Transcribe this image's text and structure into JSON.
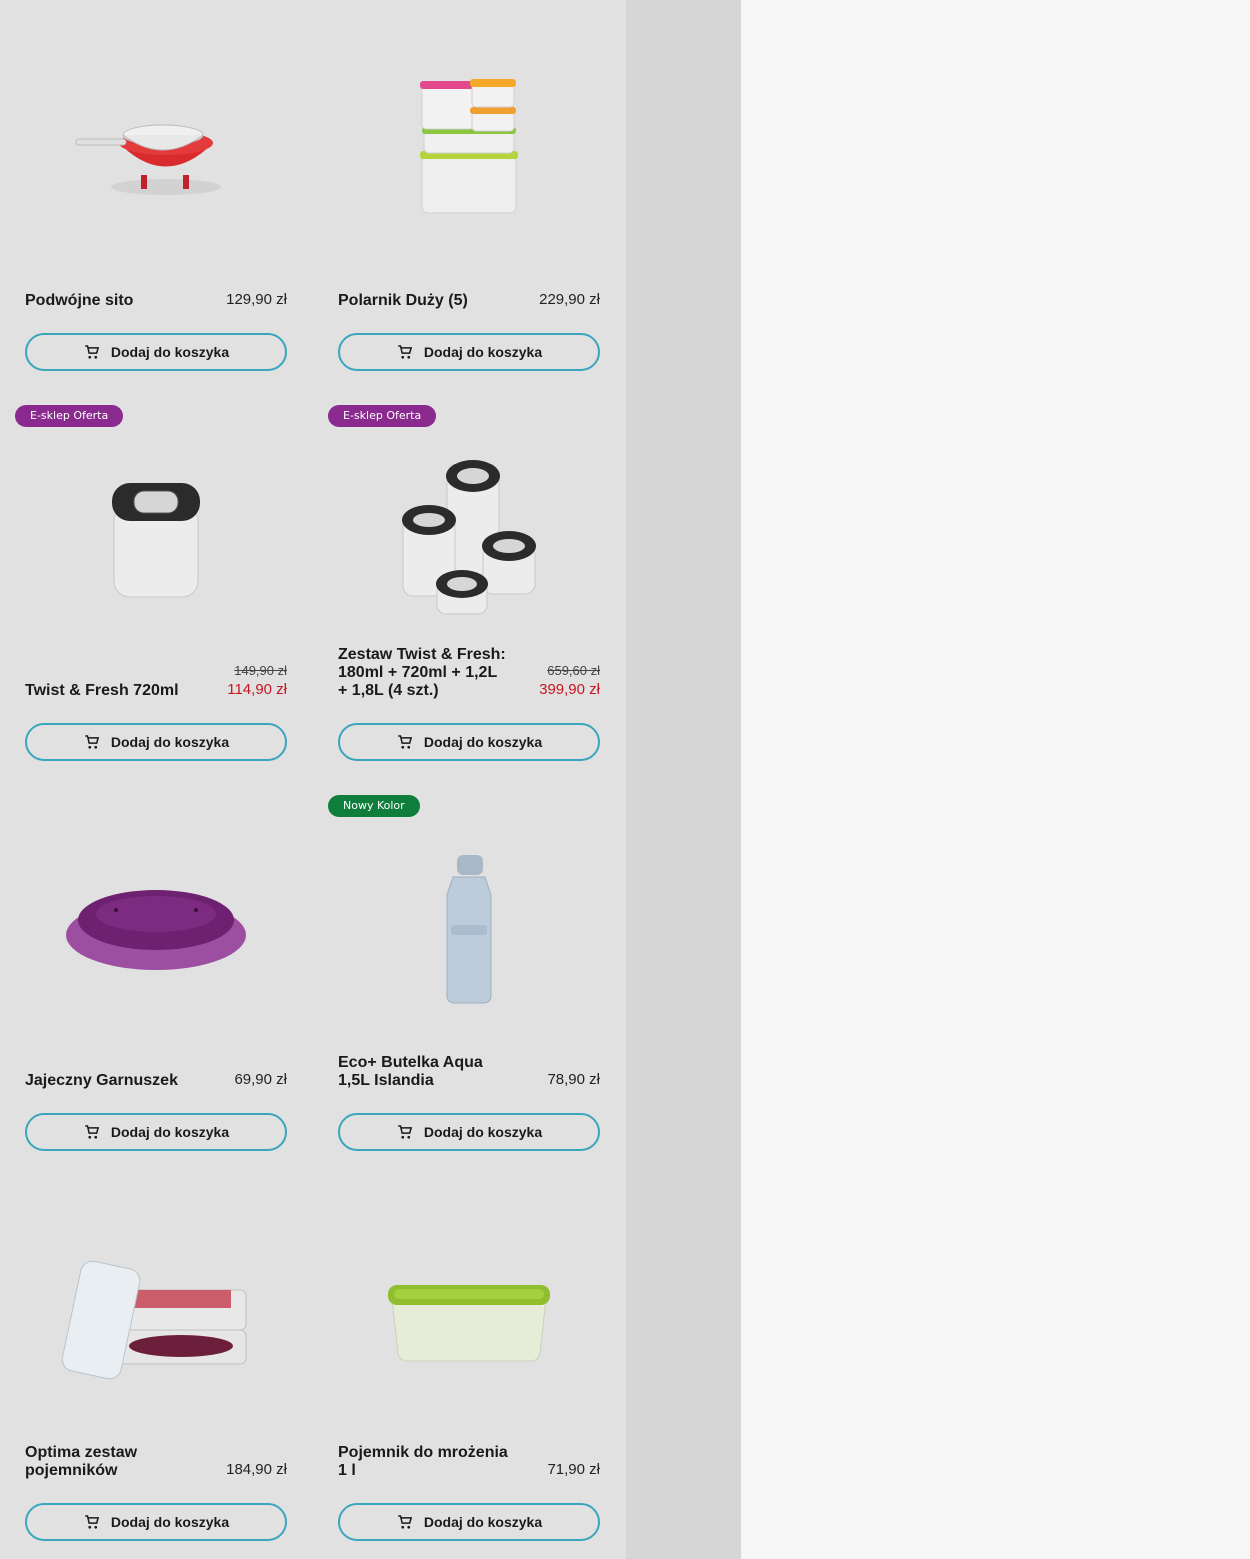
{
  "products": [
    {
      "name": "Podwójne sito",
      "price": "129,90 zł",
      "button": "Dodaj do koszyka"
    },
    {
      "name": "Polarnik Duży (5)",
      "price": "229,90 zł",
      "button": "Dodaj do koszyka"
    },
    {
      "badge": "E-sklep Oferta",
      "name": "Twist & Fresh 720ml",
      "old_price": "149,90 zł",
      "new_price": "114,90 zł",
      "button": "Dodaj do koszyka"
    },
    {
      "badge": "E-sklep Oferta",
      "name": "Zestaw Twist & Fresh: 180ml + 720ml + 1,2L + 1,8L (4 szt.)",
      "old_price": "659,60 zł",
      "new_price": "399,90 zł",
      "button": "Dodaj do koszyka"
    },
    {
      "name": "Jajeczny Garnuszek",
      "price": "69,90 zł",
      "button": "Dodaj do koszyka"
    },
    {
      "badge": "Nowy Kolor",
      "name": "Eco+ Butelka Aqua 1,5L Islandia",
      "price": "78,90 zł",
      "button": "Dodaj do koszyka"
    },
    {
      "name": "Optima zestaw pojemników",
      "price": "184,90 zł",
      "button": "Dodaj do koszyka"
    },
    {
      "name": "Pojemnik do mrożenia 1 l",
      "price": "71,90 zł",
      "button": "Dodaj do koszyka"
    }
  ],
  "colors": {
    "badge_offer": "#8a2a8e",
    "badge_new": "#0f7d3c",
    "button_border": "#3aa5bd",
    "sale_price": "#c7161f"
  }
}
